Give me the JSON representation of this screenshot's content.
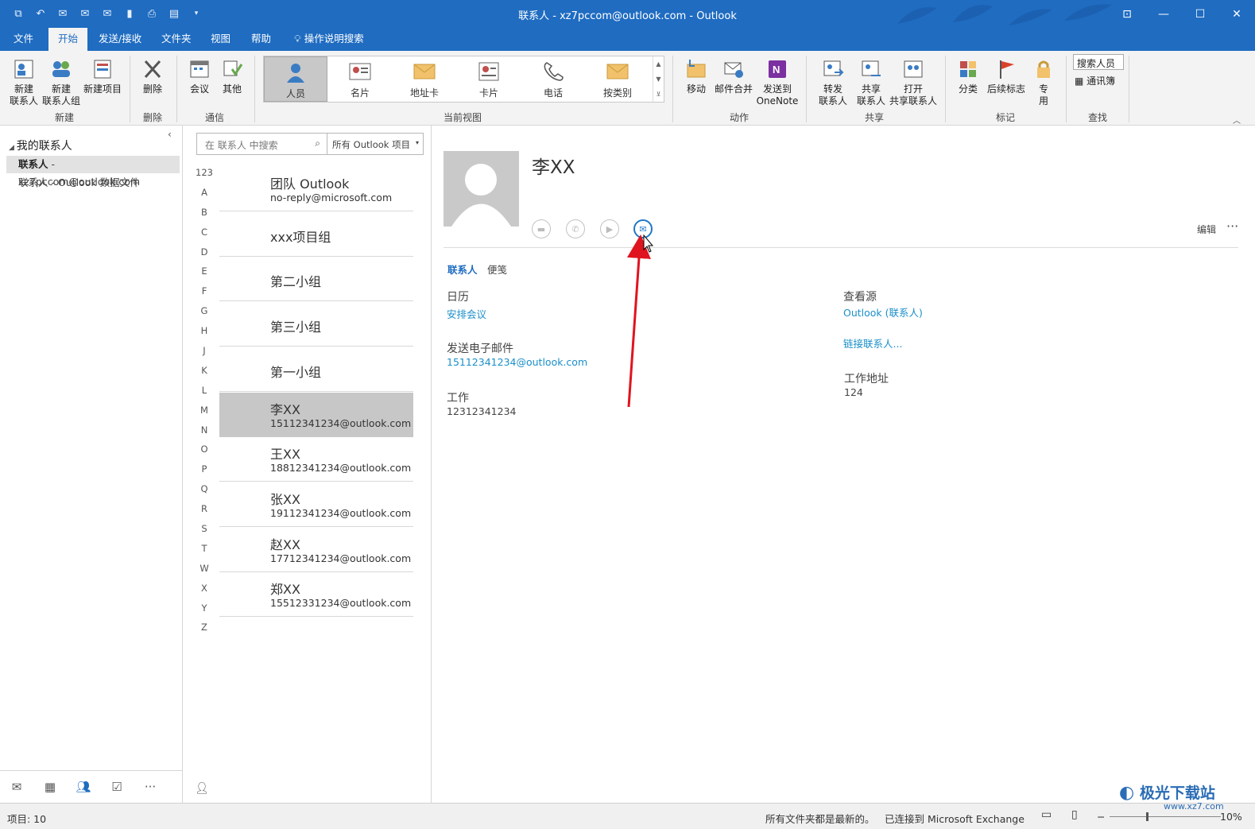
{
  "window": {
    "title": "联系人 - xz7pccom@outlook.com  -  Outlook",
    "quick_access_icons": [
      "send-receive-icon",
      "undo-icon",
      "reply-icon",
      "reply-all-icon",
      "forward-icon",
      "attach-icon",
      "print-icon",
      "touch-mode-icon",
      "customize-icon"
    ],
    "controls": [
      "⊡",
      "—",
      "☐",
      "✕"
    ]
  },
  "tabs": [
    {
      "label": "文件"
    },
    {
      "label": "开始",
      "active": true
    },
    {
      "label": "发送/接收"
    },
    {
      "label": "文件夹"
    },
    {
      "label": "视图"
    },
    {
      "label": "帮助"
    },
    {
      "label": "操作说明搜索"
    }
  ],
  "ribbon": {
    "new_contact": "新建\n联系人",
    "new_group": "新建\n联系人组",
    "new_items": "新建项目",
    "group_new": "新建",
    "delete": "删除",
    "group_delete": "删除",
    "meeting": "会议",
    "more": "其他",
    "group_comm": "通信",
    "views": [
      "人员",
      "名片",
      "地址卡",
      "卡片",
      "电话",
      "按类别"
    ],
    "group_views": "当前视图",
    "move": "移动",
    "mail_merge": "邮件合并",
    "onenote": "发送到\nOneNote",
    "group_actions": "动作",
    "forward_contact": "转发\n联系人",
    "share_contacts": "共享\n联系人",
    "open_shared": "打开\n共享联系人",
    "group_share": "共享",
    "categorize": "分类",
    "followup": "后续标志",
    "private": "专\n用",
    "group_tags": "标记",
    "search_people": "搜索人员",
    "address_book": "通讯簿",
    "group_find": "查找"
  },
  "nav": {
    "header": "我的联系人",
    "items": [
      {
        "bold": "联系人",
        "rest": " - xz7pccom@outlook.com",
        "selected": true
      },
      {
        "bold": "",
        "rest": "联系人 - Outlook 数据文件",
        "selected": false
      }
    ],
    "bottom_icons": [
      "mail-icon",
      "calendar-icon",
      "people-icon",
      "tasks-icon",
      "more-icon"
    ]
  },
  "list": {
    "search_placeholder": "在 联系人 中搜索",
    "scope": "所有 Outlook 项目",
    "letters": [
      "123",
      "A",
      "B",
      "C",
      "D",
      "E",
      "F",
      "G",
      "H",
      "J",
      "K",
      "L",
      "M",
      "N",
      "O",
      "P",
      "Q",
      "R",
      "S",
      "T",
      "W",
      "X",
      "Y",
      "Z"
    ],
    "contacts": [
      {
        "name": "团队 Outlook",
        "email": "no-reply@microsoft.com"
      },
      {
        "name": "xxx项目组",
        "email": ""
      },
      {
        "name": "第二小组",
        "email": ""
      },
      {
        "name": "第三小组",
        "email": ""
      },
      {
        "name": "第一小组",
        "email": ""
      },
      {
        "name": "李XX",
        "email": "15112341234@outlook.com",
        "selected": true
      },
      {
        "name": "王XX",
        "email": "18812341234@outlook.com"
      },
      {
        "name": "张XX",
        "email": "19112341234@outlook.com"
      },
      {
        "name": "赵XX",
        "email": "17712341234@outlook.com"
      },
      {
        "name": "郑XX",
        "email": "15512331234@outlook.com"
      }
    ]
  },
  "detail": {
    "name": "李XX",
    "edit": "编辑",
    "more": "···",
    "tabs": [
      "联系人",
      "便笺"
    ],
    "calendar_label": "日历",
    "calendar_link": "安排会议",
    "email_label": "发送电子邮件",
    "email_value": "15112341234@outlook.com",
    "work_label": "工作",
    "work_value": "12312341234",
    "source_label": "查看源",
    "source_value": "Outlook (联系人)",
    "link_contacts": "链接联系人...",
    "address_label": "工作地址",
    "address_value": "124"
  },
  "status": {
    "items": "项目: 10",
    "folders": "所有文件夹都是最新的。",
    "connection": "已连接到 Microsoft Exchange",
    "zoom": "10%"
  },
  "watermark": {
    "text": "极光下载站",
    "url": "www.xz7.com"
  },
  "colors": {
    "accent": "#1f6cc1",
    "link": "#1a8fc9",
    "arrow": "#e0141e"
  }
}
